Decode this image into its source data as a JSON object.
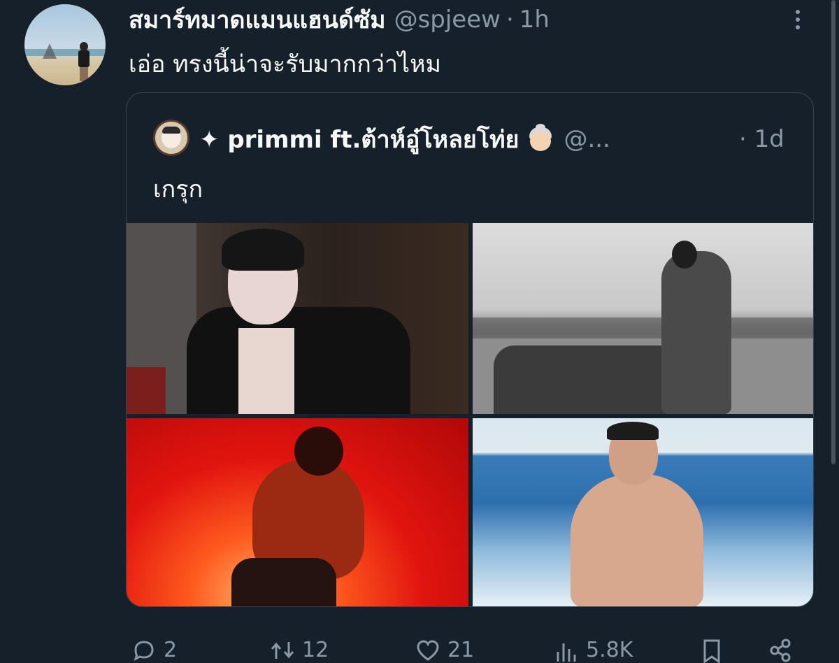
{
  "tweet": {
    "author_name": "สมาร์ทมาดแมนแฮนด์ซัม",
    "author_handle": "@spjeew",
    "separator": "·",
    "time": "1h",
    "text": "เอ่อ ทรงนี้น่าจะรับมากกว่าไหม"
  },
  "quote": {
    "author_name": "✦ primmi ft.ต้าห์อู๋โหลยโท่ย",
    "author_emoji": "older-woman-emoji",
    "author_handle": "@...",
    "time": "· 1d",
    "text": "เกรุก",
    "photos": [
      "photo-1",
      "photo-2",
      "photo-3",
      "photo-4"
    ]
  },
  "actions": {
    "reply_count": "2",
    "retweet_count": "12",
    "like_count": "21",
    "views_count": "5.8K"
  },
  "colors": {
    "background": "#15202b",
    "primary_text": "#f7f9f9",
    "secondary_text": "#8b98a5",
    "border": "#38444d"
  }
}
